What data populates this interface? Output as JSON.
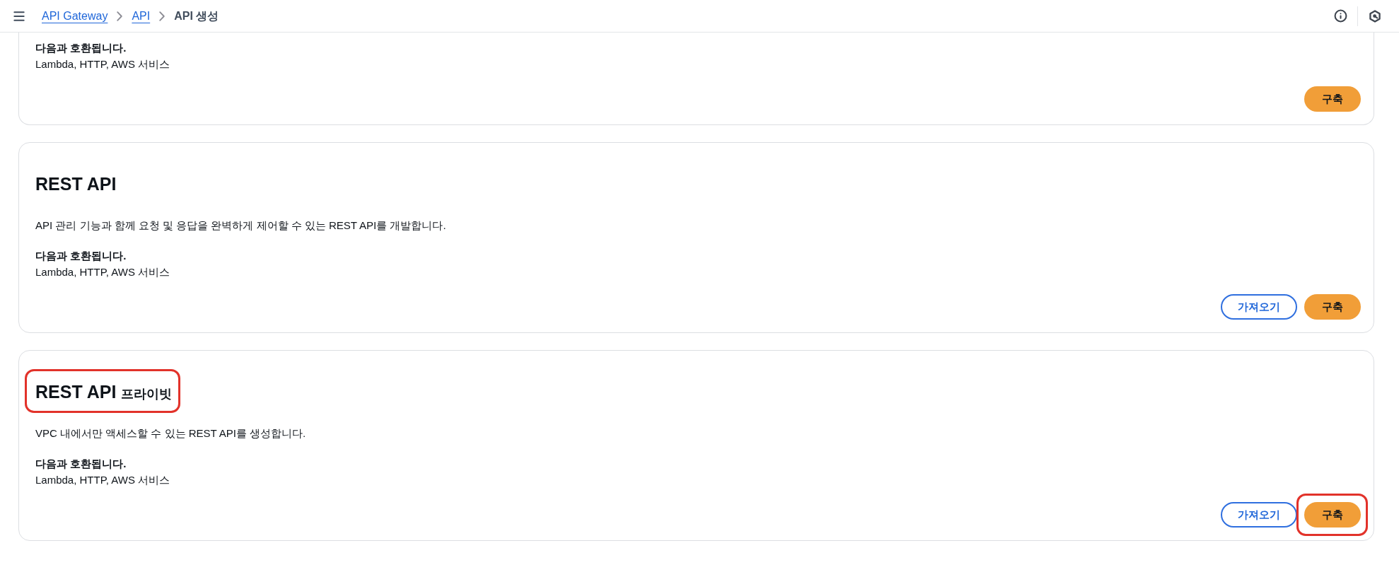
{
  "header": {
    "breadcrumbs": [
      {
        "label": "API Gateway",
        "kind": "link"
      },
      {
        "label": "API",
        "kind": "link"
      },
      {
        "label": "API 생성",
        "kind": "current"
      }
    ]
  },
  "cards": [
    {
      "compat_label": "다음과 호환됩니다.",
      "compat_value": "Lambda, HTTP, AWS 서비스",
      "buttons": [
        {
          "label": "구축",
          "kind": "primary",
          "highlighted": false
        }
      ]
    },
    {
      "title": "REST API",
      "title_highlighted": false,
      "description": "API 관리 기능과 함께 요청 및 응답을 완벽하게 제어할 수 있는 REST API를 개발합니다.",
      "compat_label": "다음과 호환됩니다.",
      "compat_value": "Lambda, HTTP, AWS 서비스",
      "buttons": [
        {
          "label": "가져오기",
          "kind": "secondary",
          "highlighted": false
        },
        {
          "label": "구축",
          "kind": "primary",
          "highlighted": false
        }
      ]
    },
    {
      "title": "REST API",
      "title_suffix": "프라이빗",
      "title_highlighted": true,
      "description": "VPC 내에서만 액세스할 수 있는 REST API를 생성합니다.",
      "compat_label": "다음과 호환됩니다.",
      "compat_value": "Lambda, HTTP, AWS 서비스",
      "buttons": [
        {
          "label": "가져오기",
          "kind": "secondary",
          "highlighted": false
        },
        {
          "label": "구축",
          "kind": "primary",
          "highlighted": true
        }
      ]
    }
  ]
}
